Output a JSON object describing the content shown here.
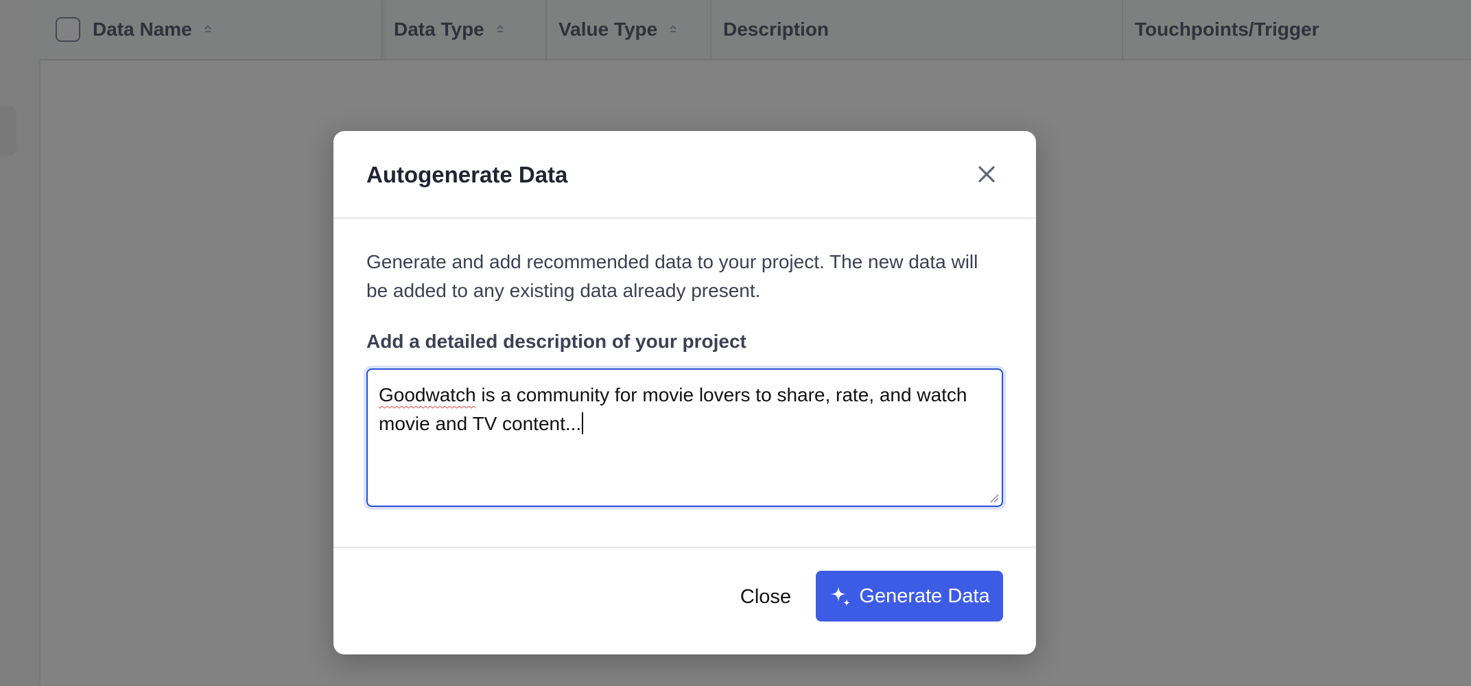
{
  "table": {
    "columns": [
      {
        "label": "Data Name",
        "sortable": true
      },
      {
        "label": "Data Type",
        "sortable": true
      },
      {
        "label": "Value Type",
        "sortable": true
      },
      {
        "label": "Description",
        "sortable": false
      },
      {
        "label": "Touchpoints/Trigger",
        "sortable": false
      }
    ]
  },
  "modal": {
    "title": "Autogenerate Data",
    "close_icon": "close-icon",
    "intro": "Generate and add recommended data to your project. The new data will be added to any existing data already present.",
    "field_label": "Add a detailed description of your project",
    "textarea": {
      "value_misspelled_word": "Goodwatch",
      "value_rest": " is a community for movie lovers to share, rate, and watch movie and TV content..."
    },
    "footer": {
      "close_label": "Close",
      "generate_label": "Generate Data",
      "generate_icon": "sparkle-icon"
    }
  },
  "colors": {
    "primary": "#3d5ce6",
    "overlay": "rgba(0,0,0,0.49)",
    "focus_border": "#2b50d6"
  }
}
